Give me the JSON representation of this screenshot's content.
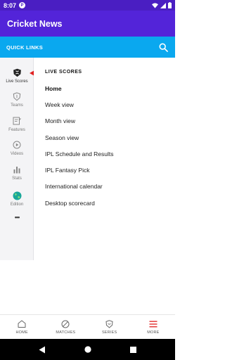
{
  "status_bar": {
    "time": "8:07",
    "app_icon_letter": "P",
    "icons": [
      "wifi-icon",
      "signal-icon",
      "battery-icon"
    ]
  },
  "app_bar": {
    "title": "Cricket News",
    "background_color": "#5324d9"
  },
  "quick_links": {
    "label": "QUICK LINKS",
    "background_color": "#0aa8ef",
    "search_icon": "search-icon"
  },
  "sidebar": {
    "items": [
      {
        "label": "Live Scores",
        "icon": "live-scores-icon",
        "active": true
      },
      {
        "label": "Teams",
        "icon": "shield-icon",
        "active": false
      },
      {
        "label": "Features",
        "icon": "features-icon",
        "active": false
      },
      {
        "label": "Videos",
        "icon": "play-icon",
        "active": false
      },
      {
        "label": "Stats",
        "icon": "bar-chart-icon",
        "active": false
      },
      {
        "label": "Edition",
        "icon": "globe-icon",
        "active": false
      }
    ],
    "more": "•••",
    "active_marker_color": "#e02020"
  },
  "panel": {
    "heading": "LIVE SCORES",
    "items": [
      "Home",
      "Week view",
      "Month view",
      "Season view",
      "IPL Schedule and Results",
      "IPL Fantasy Pick",
      "International calendar",
      "Desktop scorecard"
    ],
    "selected_index": 0
  },
  "bottom_nav": {
    "items": [
      {
        "label": "HOME",
        "icon": "home-icon"
      },
      {
        "label": "MATCHES",
        "icon": "ball-icon"
      },
      {
        "label": "SERIES",
        "icon": "series-shield-icon"
      },
      {
        "label": "MORE",
        "icon": "menu-icon"
      }
    ]
  },
  "system_nav": {
    "icons": [
      "back-icon",
      "home-circle-icon",
      "recents-icon"
    ]
  }
}
